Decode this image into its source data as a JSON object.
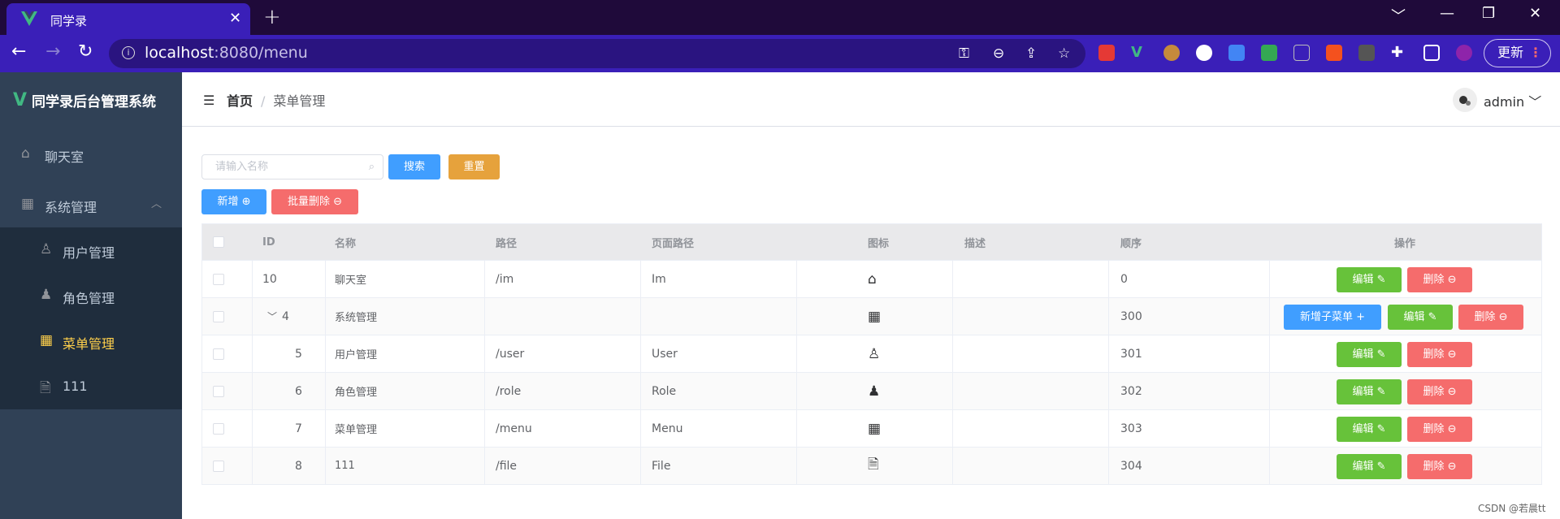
{
  "browser": {
    "tab_title": "同学录",
    "tab_close": "✕",
    "new_tab": "+",
    "url_host": "localhost",
    "url_rest": ":8080/menu",
    "update_label": "更新",
    "win_min": "﹀",
    "win_minimize": "—",
    "win_restore": "❐",
    "win_close": "✕"
  },
  "sidebar": {
    "brand_logo": "V",
    "brand": "同学录后台管理系统",
    "items": [
      {
        "label": "聊天室",
        "icon": "home-icon"
      },
      {
        "label": "系统管理",
        "icon": "grid-icon",
        "arrow": "︿"
      },
      {
        "label": "用户管理",
        "icon": "user-icon"
      },
      {
        "label": "角色管理",
        "icon": "user-solid-icon"
      },
      {
        "label": "菜单管理",
        "icon": "menu-icon"
      },
      {
        "label": "111",
        "icon": "document-icon"
      }
    ]
  },
  "header": {
    "breadcrumb_home": "首页",
    "breadcrumb_sep": "/",
    "breadcrumb_current": "菜单管理",
    "username": "admin"
  },
  "filters": {
    "search_placeholder": "请输入名称",
    "search_button": "搜索",
    "reset_button": "重置",
    "add_button": "新增",
    "batch_delete_button": "批量删除"
  },
  "table": {
    "columns": [
      "ID",
      "名称",
      "路径",
      "页面路径",
      "图标",
      "描述",
      "顺序",
      "操作"
    ],
    "edit_label": "编辑",
    "delete_label": "删除",
    "add_child_label": "新增子菜单",
    "expand_arrow": "﹀",
    "rows": [
      {
        "id": "10",
        "name": "聊天室",
        "path": "/im",
        "page_path": "Im",
        "icon": "home-icon",
        "desc": "",
        "order": "0"
      },
      {
        "id": "4",
        "name": "系统管理",
        "path": "",
        "page_path": "",
        "icon": "grid-icon",
        "desc": "",
        "order": "300"
      },
      {
        "id": "5",
        "name": "用户管理",
        "path": "/user",
        "page_path": "User",
        "icon": "user-icon",
        "desc": "",
        "order": "301"
      },
      {
        "id": "6",
        "name": "角色管理",
        "path": "/role",
        "page_path": "Role",
        "icon": "user-solid-icon",
        "desc": "",
        "order": "302"
      },
      {
        "id": "7",
        "name": "菜单管理",
        "path": "/menu",
        "page_path": "Menu",
        "icon": "menu-icon",
        "desc": "",
        "order": "303"
      },
      {
        "id": "8",
        "name": "111",
        "path": "/file",
        "page_path": "File",
        "icon": "document-icon",
        "desc": "",
        "order": "304"
      }
    ]
  },
  "watermark": "CSDN @若晨tt",
  "colors": {
    "primary": "#409eff",
    "warning": "#e6a23c",
    "danger": "#f56c6c",
    "success": "#67c23a",
    "sidebar": "#304156",
    "active_menu": "#ffd04b"
  }
}
